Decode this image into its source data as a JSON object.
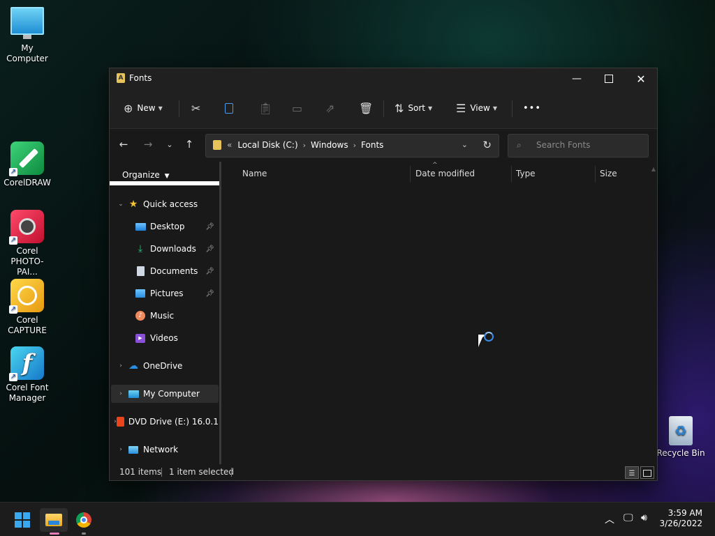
{
  "desktop": {
    "icons": [
      {
        "label": "My Computer",
        "icon": "monitor-icon"
      },
      {
        "label": "CorelDRAW",
        "icon": "coreldraw-icon"
      },
      {
        "label": "Corel PHOTO-PAI...",
        "icon": "corel-photopaint-icon"
      },
      {
        "label": "Corel CAPTURE",
        "icon": "corel-capture-icon"
      },
      {
        "label": "Corel Font Manager",
        "icon": "corel-font-manager-icon"
      },
      {
        "label": "Recycle Bin",
        "icon": "recycle-bin-icon"
      }
    ]
  },
  "window": {
    "title": "Fonts",
    "controls": {
      "minimize": "minimize-icon",
      "maximize": "maximize-icon",
      "close": "close-icon"
    }
  },
  "toolbar": {
    "new_label": "New",
    "sort_label": "Sort",
    "view_label": "View",
    "more_label": "•••"
  },
  "address": {
    "prefix": "«",
    "crumbs": [
      "Local Disk (C:)",
      "Windows",
      "Fonts"
    ]
  },
  "search": {
    "placeholder": "Search Fonts"
  },
  "nav_pane": {
    "organize_label": "Organize",
    "quick_access": "Quick access",
    "pinned": [
      "Desktop",
      "Downloads",
      "Documents",
      "Pictures"
    ],
    "unpinned": [
      "Music",
      "Videos"
    ],
    "onedrive": "OneDrive",
    "my_computer": "My Computer",
    "dvd_drive": "DVD Drive (E:) 16.0.1",
    "network": "Network"
  },
  "columns": [
    "Name",
    "Date modified",
    "Type",
    "Size"
  ],
  "status": {
    "items": "101 items",
    "selected": "1 item selected"
  },
  "taskbar": {
    "time": "3:59 AM",
    "date": "3/26/2022"
  },
  "colors": {
    "accent": "#3a8ee6",
    "window_bg": "#191919",
    "titlebar_bg": "#202020",
    "folder_yellow": "#e7c45a"
  }
}
